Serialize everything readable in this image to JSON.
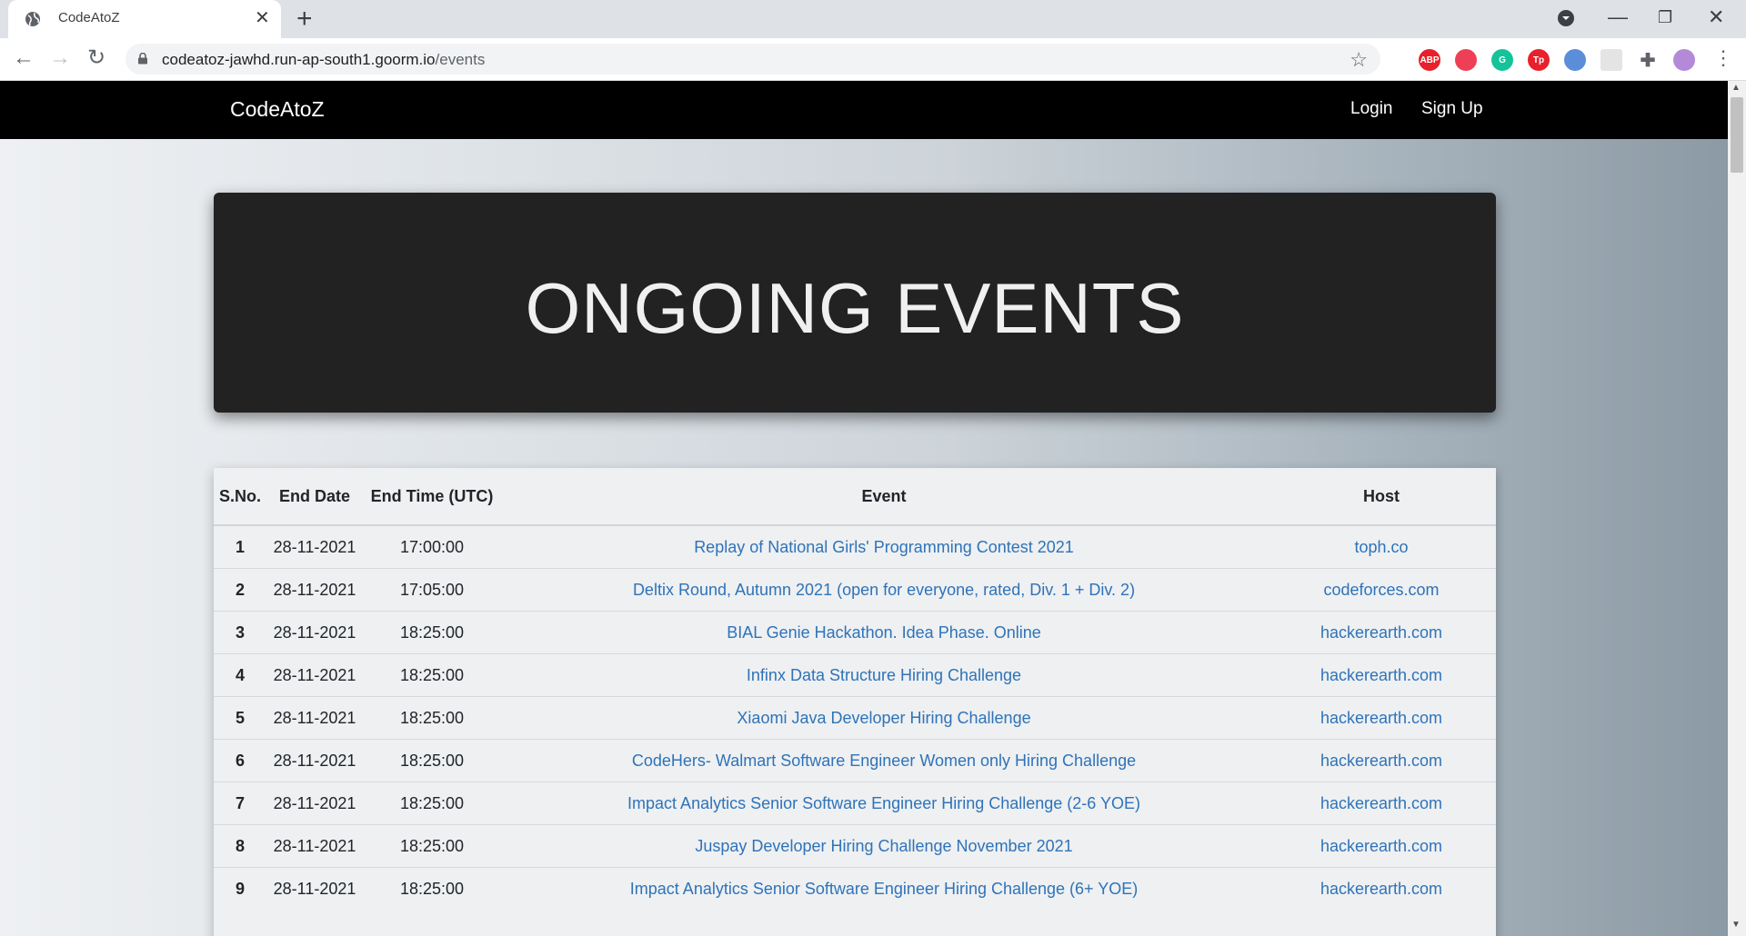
{
  "browser": {
    "tab_title": "CodeAtoZ",
    "url_host": "codeatoz-jawhd.run-ap-south1.goorm.io",
    "url_path": "/events",
    "extensions": [
      {
        "name": "adblock-icon",
        "label": "ABP",
        "color": "#e8202b"
      },
      {
        "name": "pocket-icon",
        "label": "",
        "color": "#ef3f56"
      },
      {
        "name": "grammarly-icon",
        "label": "G",
        "color": "#15c39a"
      },
      {
        "name": "tp-icon",
        "label": "Tp",
        "color": "#e8202b"
      },
      {
        "name": "ext-blue-icon",
        "label": "",
        "color": "#5b8ed8"
      },
      {
        "name": "ext-grey-icon",
        "label": "",
        "color": "#e4e4e4"
      },
      {
        "name": "extensions-puzzle-icon",
        "label": "",
        "color": "#5f6368"
      },
      {
        "name": "profile-avatar-icon",
        "label": "",
        "color": "#b48ad8"
      }
    ]
  },
  "nav": {
    "brand": "CodeAtoZ",
    "login": "Login",
    "signup": "Sign Up"
  },
  "hero": {
    "title": "ONGOING EVENTS"
  },
  "table": {
    "headers": [
      "S.No.",
      "End Date",
      "End Time (UTC)",
      "Event",
      "Host"
    ],
    "rows": [
      {
        "sno": "1",
        "date": "28-11-2021",
        "time": "17:00:00",
        "event": "Replay of National Girls' Programming Contest 2021",
        "host": "toph.co"
      },
      {
        "sno": "2",
        "date": "28-11-2021",
        "time": "17:05:00",
        "event": "Deltix Round, Autumn 2021 (open for everyone, rated, Div. 1 + Div. 2)",
        "host": "codeforces.com"
      },
      {
        "sno": "3",
        "date": "28-11-2021",
        "time": "18:25:00",
        "event": "BIAL Genie Hackathon. Idea Phase. Online",
        "host": "hackerearth.com"
      },
      {
        "sno": "4",
        "date": "28-11-2021",
        "time": "18:25:00",
        "event": "Infinx Data Structure Hiring Challenge",
        "host": "hackerearth.com"
      },
      {
        "sno": "5",
        "date": "28-11-2021",
        "time": "18:25:00",
        "event": "Xiaomi Java Developer Hiring Challenge",
        "host": "hackerearth.com"
      },
      {
        "sno": "6",
        "date": "28-11-2021",
        "time": "18:25:00",
        "event": "CodeHers- Walmart Software Engineer Women only Hiring Challenge",
        "host": "hackerearth.com"
      },
      {
        "sno": "7",
        "date": "28-11-2021",
        "time": "18:25:00",
        "event": "Impact Analytics Senior Software Engineer Hiring Challenge (2-6 YOE)",
        "host": "hackerearth.com"
      },
      {
        "sno": "8",
        "date": "28-11-2021",
        "time": "18:25:00",
        "event": "Juspay Developer Hiring Challenge November 2021",
        "host": "hackerearth.com"
      },
      {
        "sno": "9",
        "date": "28-11-2021",
        "time": "18:25:00",
        "event": "Impact Analytics Senior Software Engineer Hiring Challenge (6+ YOE)",
        "host": "hackerearth.com"
      }
    ]
  }
}
